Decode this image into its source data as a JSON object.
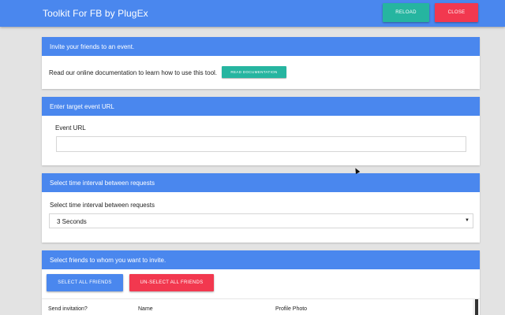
{
  "header": {
    "title": "Toolkit For FB by PlugEx",
    "reload_label": "RELOAD",
    "close_label": "CLOSE"
  },
  "invite_card": {
    "heading": "Invite your friends to an event.",
    "doc_text": "Read our online documentation to learn how to use this tool.",
    "doc_button_label": "READ DOCUMENTATION"
  },
  "event_card": {
    "heading": "Enter target event URL",
    "field_label": "Event URL",
    "field_value": "",
    "field_placeholder": ""
  },
  "interval_card": {
    "heading": "Select time interval between requests",
    "field_label": "Select time interval between requests",
    "selected_value": "3 Seconds"
  },
  "friends_card": {
    "heading": "Select friends to whom you want to invite.",
    "select_all_label": "SELECT ALL FRIENDS",
    "unselect_all_label": "UN-SELECT ALL FRIENDS",
    "columns": [
      "Send invitation?",
      "Name",
      "Profile Photo"
    ]
  },
  "icons": {
    "dropdown": "caret-down-icon",
    "cursor": "mouse-pointer-icon"
  },
  "colors": {
    "primary": "#4a87ee",
    "teal": "#26b5a0",
    "red": "#f2384f",
    "background": "#e3e3e3"
  }
}
